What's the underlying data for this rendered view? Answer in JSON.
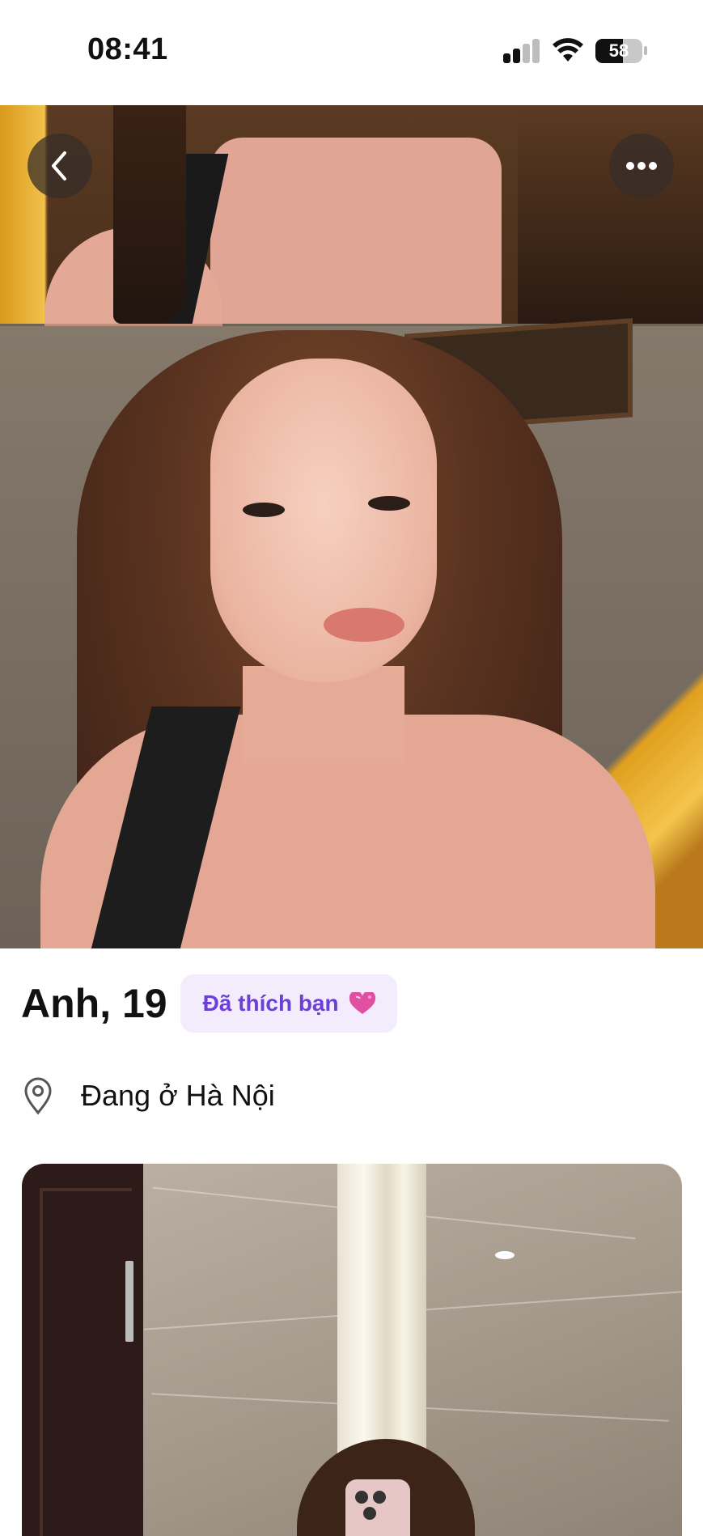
{
  "status_bar": {
    "time": "08:41",
    "battery_level": "58",
    "icons": [
      "cellular-signal-icon",
      "wifi-icon",
      "battery-icon"
    ]
  },
  "header": {
    "back_icon": "chevron-left-icon",
    "more_icon": "more-horizontal-icon"
  },
  "profile": {
    "name_age": "Anh, 19",
    "liked_badge": "Đã thích bạn",
    "liked_icon": "heart-icon",
    "location_icon": "location-pin-icon",
    "location": "Đang ở Hà Nội"
  },
  "colors": {
    "badge_bg": "#f3ecfd",
    "badge_text": "#6c3fd6",
    "overlay_button": "#372d28"
  }
}
